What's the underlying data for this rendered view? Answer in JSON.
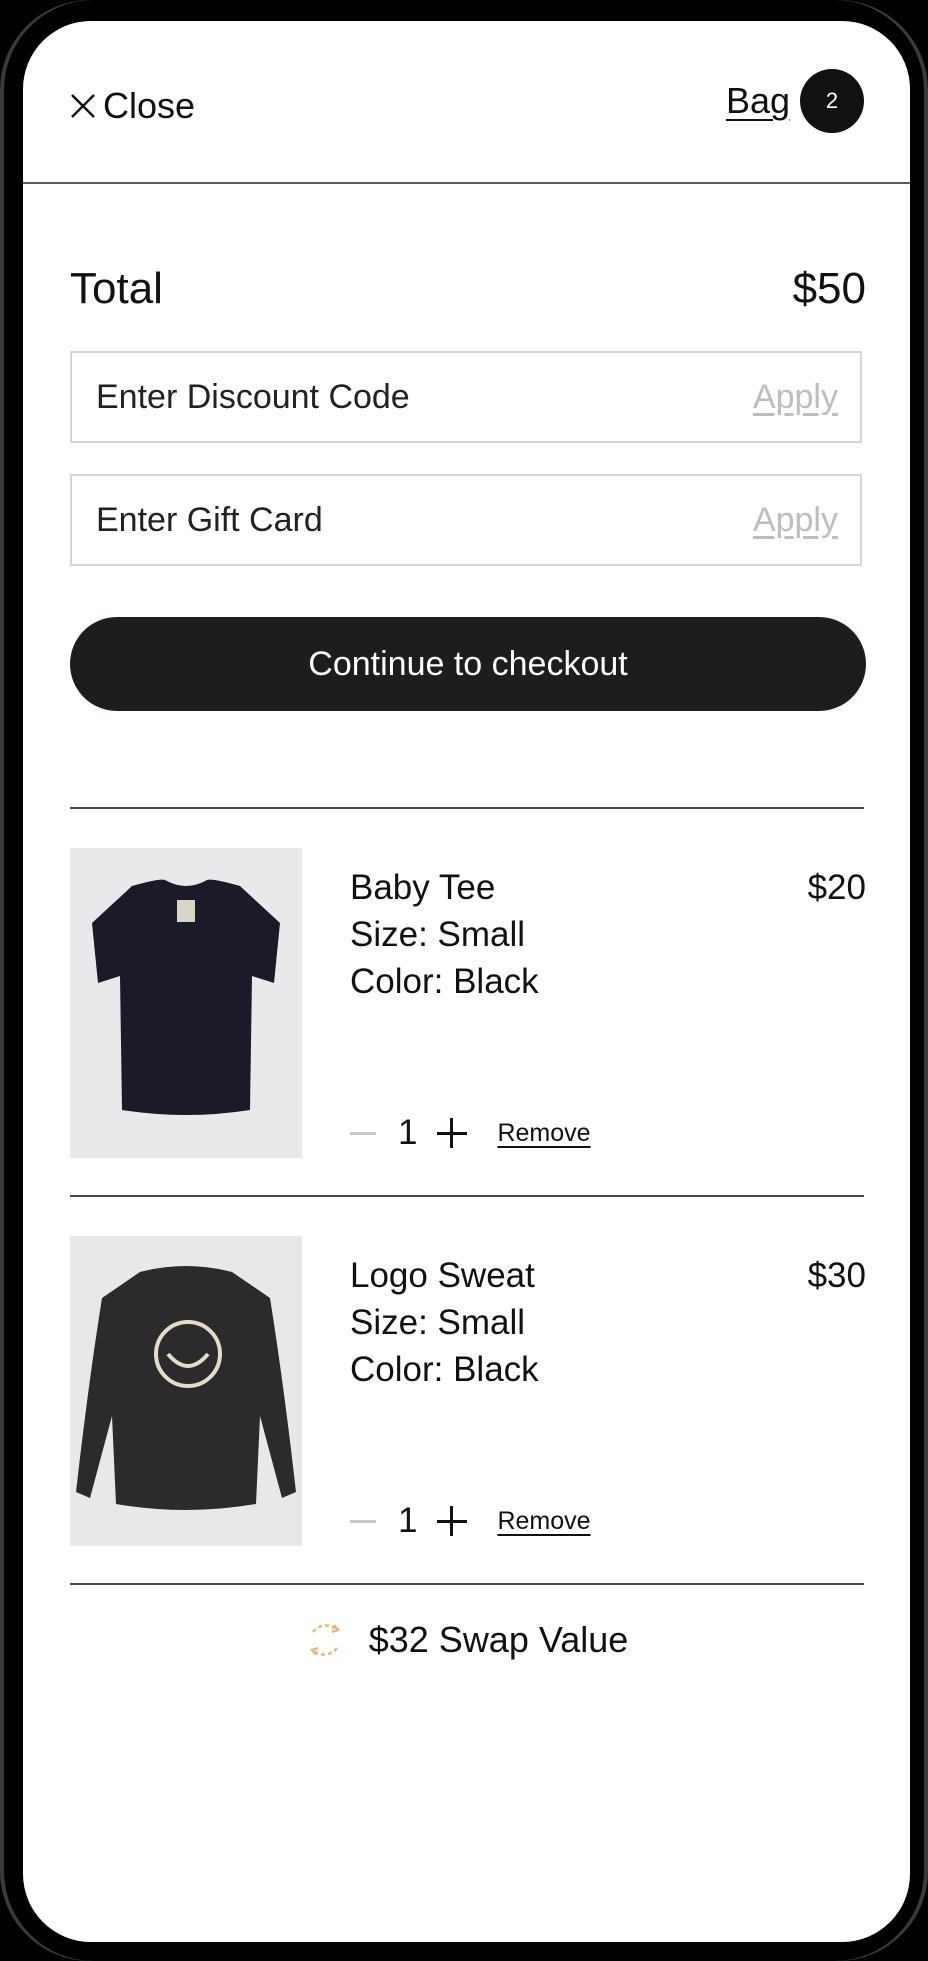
{
  "header": {
    "close_label": "Close",
    "bag_label": "Bag",
    "bag_count": "2"
  },
  "summary": {
    "total_label": "Total",
    "total_value": "$50"
  },
  "discount": {
    "placeholder": "Enter Discount Code",
    "apply_label": "Apply"
  },
  "gift_card": {
    "placeholder": "Enter Gift Card",
    "apply_label": "Apply"
  },
  "checkout": {
    "label": "Continue to checkout"
  },
  "items": [
    {
      "name": "Baby Tee",
      "size": "Size: Small",
      "color": "Color: Black",
      "price": "$20",
      "quantity": "1",
      "remove_label": "Remove"
    },
    {
      "name": "Logo Sweat",
      "size": "Size: Small",
      "color": "Color: Black",
      "price": "$30",
      "quantity": "1",
      "remove_label": "Remove"
    }
  ],
  "swap": {
    "label": "$32 Swap Value",
    "icon": "swap-cycle-icon",
    "icon_color": "#e8b878"
  },
  "colors": {
    "button_dark": "#1e1c1d",
    "badge": "#111111",
    "apply_link": "#bdbdbd"
  }
}
